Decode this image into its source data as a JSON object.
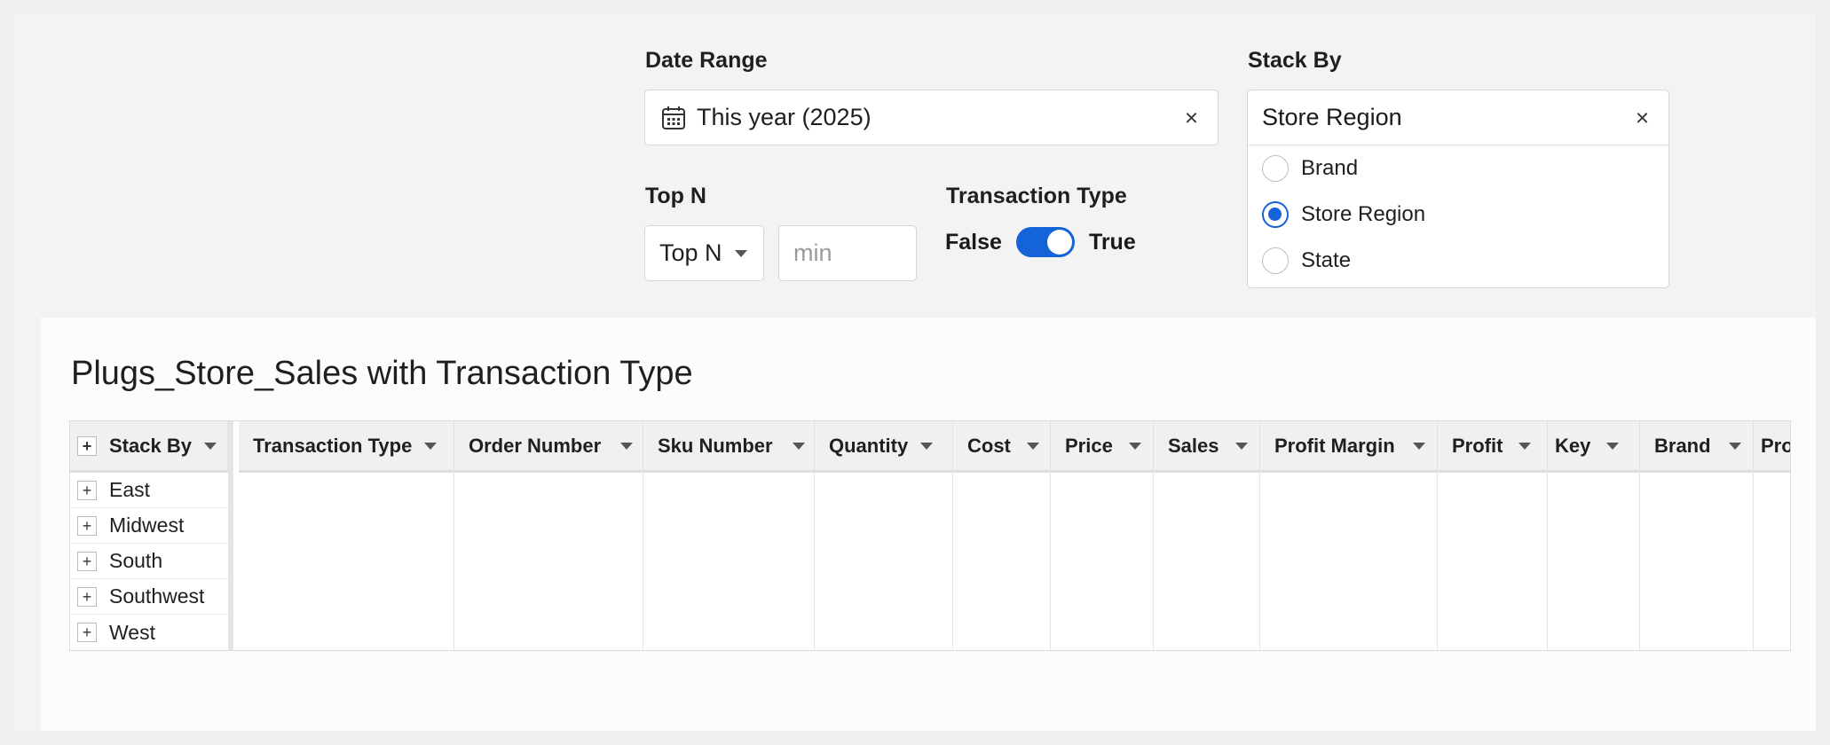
{
  "controls": {
    "date_range": {
      "label": "Date Range",
      "value": "This year (2025)",
      "clear": "×"
    },
    "stack_by": {
      "label": "Stack By",
      "value": "Store Region",
      "clear": "×",
      "options": [
        "Brand",
        "Store Region",
        "State"
      ],
      "selected": "Store Region"
    },
    "top_n": {
      "label": "Top N",
      "select_value": "Top N",
      "input_placeholder": "min"
    },
    "transaction_type": {
      "label": "Transaction Type",
      "false_label": "False",
      "true_label": "True",
      "on": true
    }
  },
  "table": {
    "title": "Plugs_Store_Sales with Transaction Type",
    "row_header": "Stack By",
    "rows": [
      "East",
      "Midwest",
      "South",
      "Southwest",
      "West"
    ],
    "columns": [
      "Transaction Type",
      "Order Number",
      "Sku Number",
      "Quantity",
      "Cost",
      "Price",
      "Sales",
      "Profit Margin",
      "Profit",
      "Key",
      "Brand",
      "Pro"
    ]
  },
  "colors": {
    "accent": "#1463d8"
  }
}
